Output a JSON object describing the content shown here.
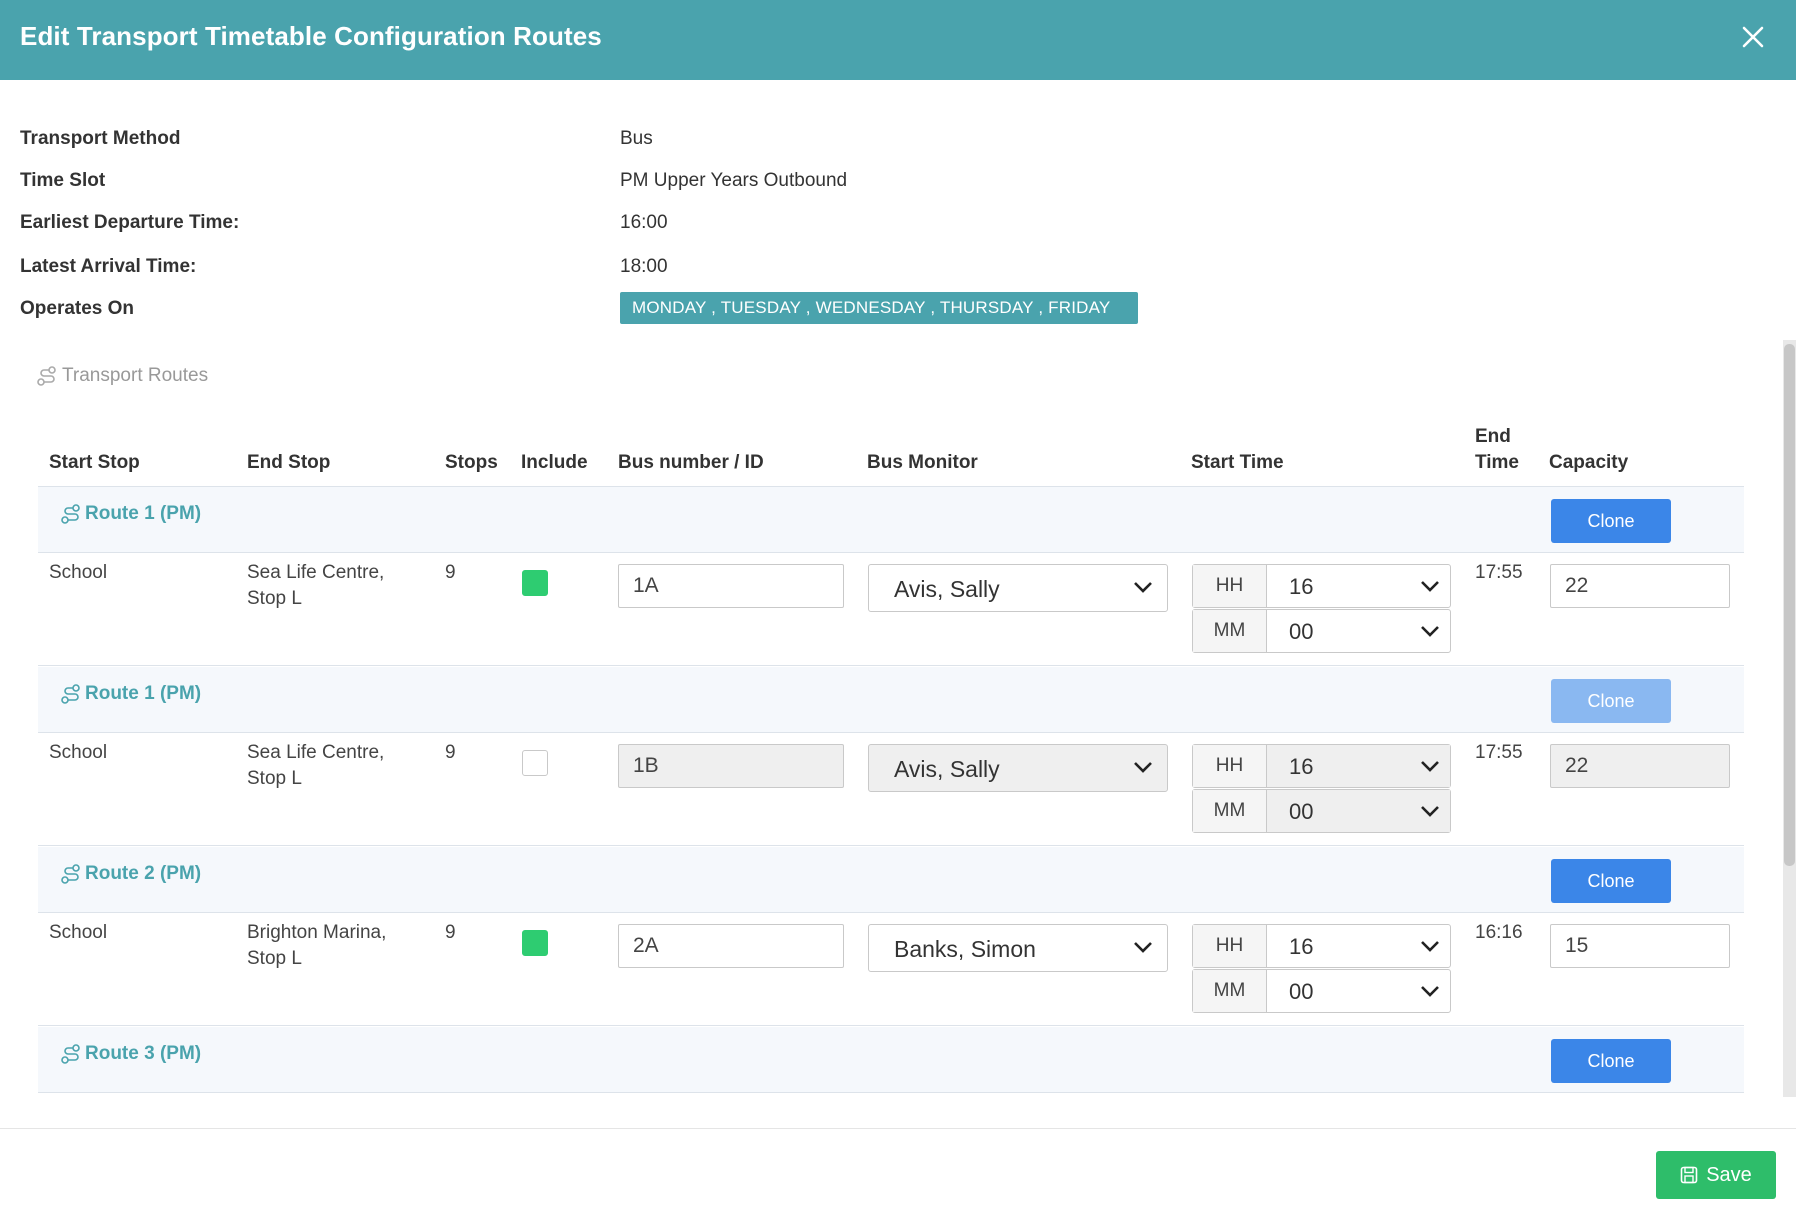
{
  "modal": {
    "title": "Edit Transport Timetable Configuration Routes"
  },
  "info": {
    "transport_method_label": "Transport Method",
    "transport_method_value": "Bus",
    "time_slot_label": "Time Slot",
    "time_slot_value": "PM Upper Years Outbound",
    "earliest_departure_label": "Earliest Departure Time:",
    "earliest_departure_value": "16:00",
    "latest_arrival_label": "Latest Arrival Time:",
    "latest_arrival_value": "18:00",
    "operates_on_label": "Operates On",
    "operates_on_value": "MONDAY , TUESDAY , WEDNESDAY , THURSDAY , FRIDAY"
  },
  "section": {
    "title": "Transport Routes"
  },
  "table": {
    "headers": {
      "start_stop": "Start Stop",
      "end_stop": "End Stop",
      "stops": "Stops",
      "include": "Include",
      "bus_number": "Bus number / ID",
      "bus_monitor": "Bus Monitor",
      "start_time": "Start Time",
      "end_time_line1": "End",
      "end_time_line2": "Time",
      "capacity": "Capacity"
    },
    "clone_label": "Clone",
    "hh_label": "HH",
    "mm_label": "MM",
    "groups": [
      {
        "title": "Route 1 (PM)",
        "clone_enabled": true,
        "row": {
          "start_stop": "School",
          "end_stop_line1": "Sea Life Centre,",
          "end_stop_line2": "Stop L",
          "stops": "9",
          "included": true,
          "bus_number": "1A",
          "bus_monitor": "Avis, Sally",
          "hh": "16",
          "mm": "00",
          "end_time": "17:55",
          "capacity": "22"
        }
      },
      {
        "title": "Route 1 (PM)",
        "clone_enabled": false,
        "row": {
          "start_stop": "School",
          "end_stop_line1": "Sea Life Centre,",
          "end_stop_line2": "Stop L",
          "stops": "9",
          "included": false,
          "bus_number": "1B",
          "bus_monitor": "Avis, Sally",
          "hh": "16",
          "mm": "00",
          "end_time": "17:55",
          "capacity": "22"
        }
      },
      {
        "title": "Route 2 (PM)",
        "clone_enabled": true,
        "row": {
          "start_stop": "School",
          "end_stop_line1": "Brighton Marina,",
          "end_stop_line2": "Stop L",
          "stops": "9",
          "included": true,
          "bus_number": "2A",
          "bus_monitor": "Banks, Simon",
          "hh": "16",
          "mm": "00",
          "end_time": "16:16",
          "capacity": "15"
        }
      },
      {
        "title": "Route 3 (PM)",
        "clone_enabled": true
      }
    ]
  },
  "footer": {
    "save_label": "Save"
  },
  "colors": {
    "header": "#4aa3ad",
    "clone": "#3b86e8",
    "clone_disabled": "#8ab8f1",
    "save": "#2ebd6a",
    "checkbox_checked": "#2ecc71"
  }
}
